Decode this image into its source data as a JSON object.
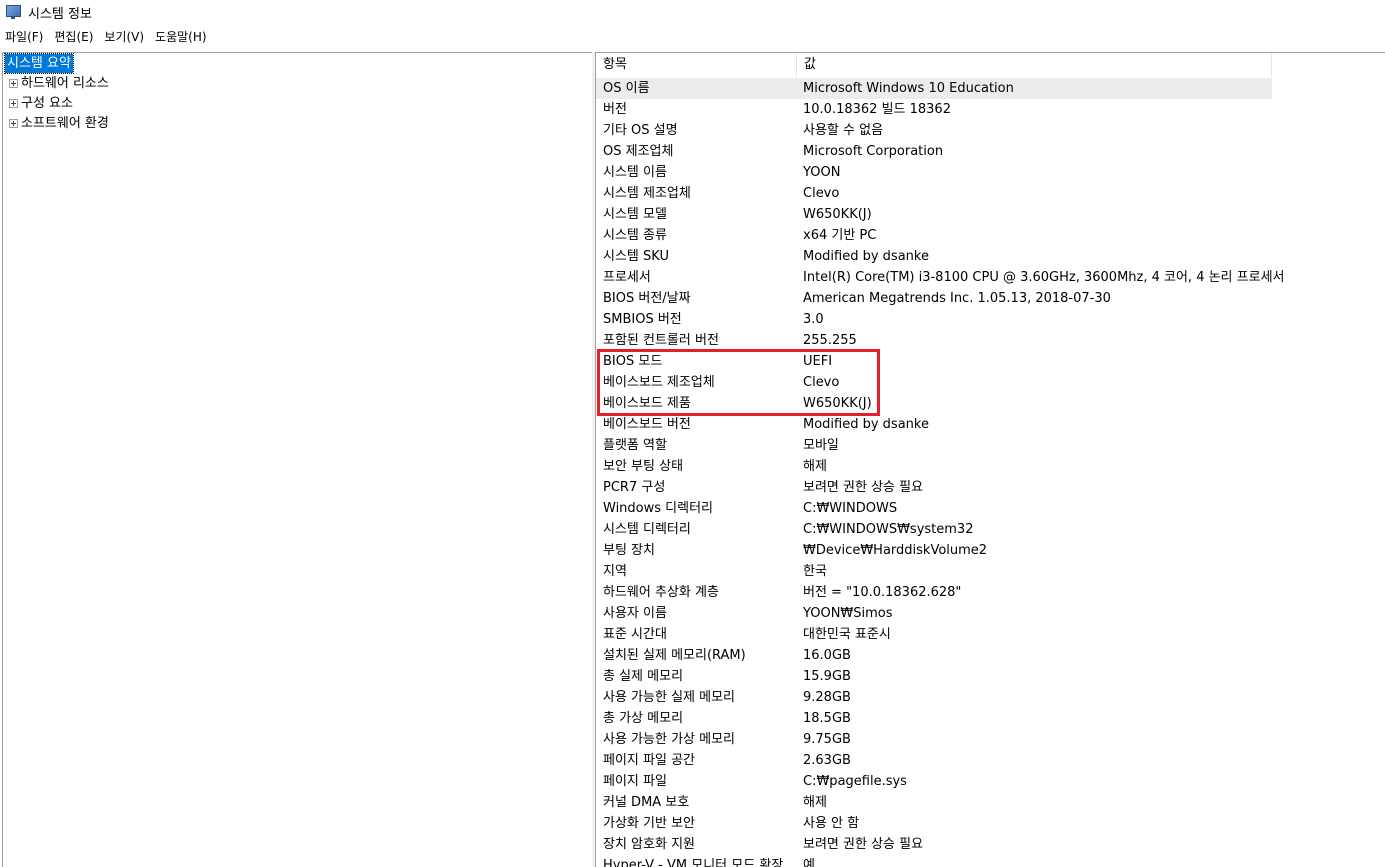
{
  "window": {
    "title": "시스템 정보",
    "icon": "system-info-icon"
  },
  "menu": [
    "파일(F)",
    "편집(E)",
    "보기(V)",
    "도움말(H)"
  ],
  "tree": {
    "root": "시스템 요약",
    "children": [
      "하드웨어 리소스",
      "구성 요소",
      "소프트웨어 환경"
    ]
  },
  "list": {
    "headers": {
      "item": "항목",
      "value": "값"
    },
    "rows": [
      {
        "item": "OS 이름",
        "value": "Microsoft Windows 10 Education"
      },
      {
        "item": "버전",
        "value": "10.0.18362 빌드 18362"
      },
      {
        "item": "기타 OS 설명",
        "value": "사용할 수 없음"
      },
      {
        "item": "OS 제조업체",
        "value": "Microsoft Corporation"
      },
      {
        "item": "시스템 이름",
        "value": "YOON"
      },
      {
        "item": "시스템 제조업체",
        "value": "Clevo"
      },
      {
        "item": "시스템 모델",
        "value": "W650KK(J)"
      },
      {
        "item": "시스템 종류",
        "value": "x64 기반 PC"
      },
      {
        "item": "시스템 SKU",
        "value": "Modified by dsanke"
      },
      {
        "item": "프로세서",
        "value": "Intel(R) Core(TM) i3-8100 CPU @ 3.60GHz, 3600Mhz, 4 코어, 4 논리 프로세서"
      },
      {
        "item": "BIOS 버전/날짜",
        "value": "American Megatrends Inc. 1.05.13, 2018-07-30"
      },
      {
        "item": "SMBIOS 버전",
        "value": "3.0"
      },
      {
        "item": "포함된 컨트롤러 버전",
        "value": "255.255"
      },
      {
        "item": "BIOS 모드",
        "value": "UEFI"
      },
      {
        "item": "베이스보드 제조업체",
        "value": "Clevo"
      },
      {
        "item": "베이스보드 제품",
        "value": "W650KK(J)"
      },
      {
        "item": "베이스보드 버전",
        "value": "Modified by dsanke"
      },
      {
        "item": "플랫폼 역할",
        "value": "모바일"
      },
      {
        "item": "보안 부팅 상태",
        "value": "해제"
      },
      {
        "item": "PCR7 구성",
        "value": "보려면 권한 상승 필요"
      },
      {
        "item": "Windows 디렉터리",
        "value": "C:₩WINDOWS"
      },
      {
        "item": "시스템 디렉터리",
        "value": "C:₩WINDOWS₩system32"
      },
      {
        "item": "부팅 장치",
        "value": "₩Device₩HarddiskVolume2"
      },
      {
        "item": "지역",
        "value": "한국"
      },
      {
        "item": "하드웨어 추상화 계층",
        "value": "버전 = \"10.0.18362.628\""
      },
      {
        "item": "사용자 이름",
        "value": "YOON₩Simos"
      },
      {
        "item": "표준 시간대",
        "value": "대한민국 표준시"
      },
      {
        "item": "설치된 실제 메모리(RAM)",
        "value": "16.0GB"
      },
      {
        "item": "총 실제 메모리",
        "value": "15.9GB"
      },
      {
        "item": "사용 가능한 실제 메모리",
        "value": "9.28GB"
      },
      {
        "item": "총 가상 메모리",
        "value": "18.5GB"
      },
      {
        "item": "사용 가능한 가상 메모리",
        "value": "9.75GB"
      },
      {
        "item": "페이지 파일 공간",
        "value": "2.63GB"
      },
      {
        "item": "페이지 파일",
        "value": "C:₩pagefile.sys"
      },
      {
        "item": "커널 DMA 보호",
        "value": "해제"
      },
      {
        "item": "가상화 기반 보안",
        "value": "사용 안 함"
      },
      {
        "item": "장치 암호화 지원",
        "value": "보려면 권한 상승 필요"
      },
      {
        "item": "Hyper-V - VM 모니터 모드 확장",
        "value": "예"
      }
    ]
  },
  "colors": {
    "selection": "#0078d7",
    "highlight_box": "#e3202a",
    "selected_row": "#ececec"
  }
}
